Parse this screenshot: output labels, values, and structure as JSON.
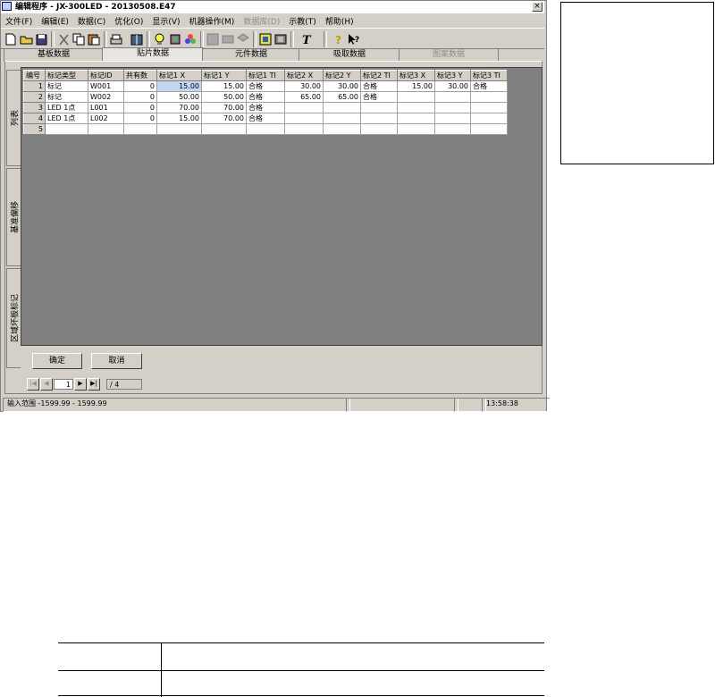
{
  "window": {
    "title": "编辑程序 - JX-300LED - 20130508.E47",
    "close_label": "×"
  },
  "menu": [
    {
      "label": "文件(F)",
      "disabled": false
    },
    {
      "label": "编辑(E)",
      "disabled": false
    },
    {
      "label": "数据(C)",
      "disabled": false
    },
    {
      "label": "优化(O)",
      "disabled": false
    },
    {
      "label": "显示(V)",
      "disabled": false
    },
    {
      "label": "机器操作(M)",
      "disabled": false
    },
    {
      "label": "数据库(D)",
      "disabled": true
    },
    {
      "label": "示教(T)",
      "disabled": false
    },
    {
      "label": "帮助(H)",
      "disabled": false
    }
  ],
  "toolbar_icons": [
    "new-file-icon",
    "open-folder-icon",
    "save-icon",
    "cut-icon",
    "copy-icon",
    "paste-icon",
    "print-icon",
    "book-icon",
    "bulb-icon",
    "component-icon",
    "group-icon",
    "grid-disabled-icon",
    "stack-disabled-icon",
    "layer-disabled-icon",
    "camera-icon",
    "rail-icon",
    "text-icon",
    "help-icon",
    "context-help-icon"
  ],
  "top_tabs": [
    {
      "label": "基板数据",
      "state": "normal"
    },
    {
      "label": "贴片数据",
      "state": "active"
    },
    {
      "label": "元件数据",
      "state": "normal"
    },
    {
      "label": "吸取数据",
      "state": "normal"
    },
    {
      "label": "图案数据",
      "state": "disabled"
    }
  ],
  "side_tabs": [
    {
      "label": "列表"
    },
    {
      "label": "基准偏移"
    },
    {
      "label": "区域坏板标记"
    }
  ],
  "grid": {
    "headers": [
      "编号",
      "标记类型",
      "标记ID",
      "共有数",
      "标记1 X",
      "标记1 Y",
      "标记1 TI",
      "标记2 X",
      "标记2 Y",
      "标记2 TI",
      "标记3 X",
      "标记3 Y",
      "标记3 TI"
    ],
    "rows": [
      [
        "1",
        "标记",
        "W001",
        "0",
        "15.00",
        "15.00",
        "合格",
        "30.00",
        "30.00",
        "合格",
        "15.00",
        "30.00",
        "合格"
      ],
      [
        "2",
        "标记",
        "W002",
        "0",
        "50.00",
        "50.00",
        "合格",
        "65.00",
        "65.00",
        "合格",
        "",
        "",
        ""
      ],
      [
        "3",
        "LED 1点",
        "L001",
        "0",
        "70.00",
        "70.00",
        "合格",
        "",
        "",
        "",
        "",
        "",
        ""
      ],
      [
        "4",
        "LED 1点",
        "L002",
        "0",
        "15.00",
        "70.00",
        "合格",
        "",
        "",
        "",
        "",
        "",
        ""
      ],
      [
        "5",
        "",
        "",
        "",
        "",
        "",
        "",
        "",
        "",
        "",
        "",
        "",
        ""
      ]
    ]
  },
  "buttons": {
    "ok": "确定",
    "cancel": "取消"
  },
  "pager": {
    "first": "|◀",
    "prev": "◀",
    "current": "1",
    "next": "▶",
    "last": "▶|",
    "total": "/ 4"
  },
  "status": {
    "range": "输入范围  -1599.99 - 1599.99",
    "time": "13:58:38"
  }
}
